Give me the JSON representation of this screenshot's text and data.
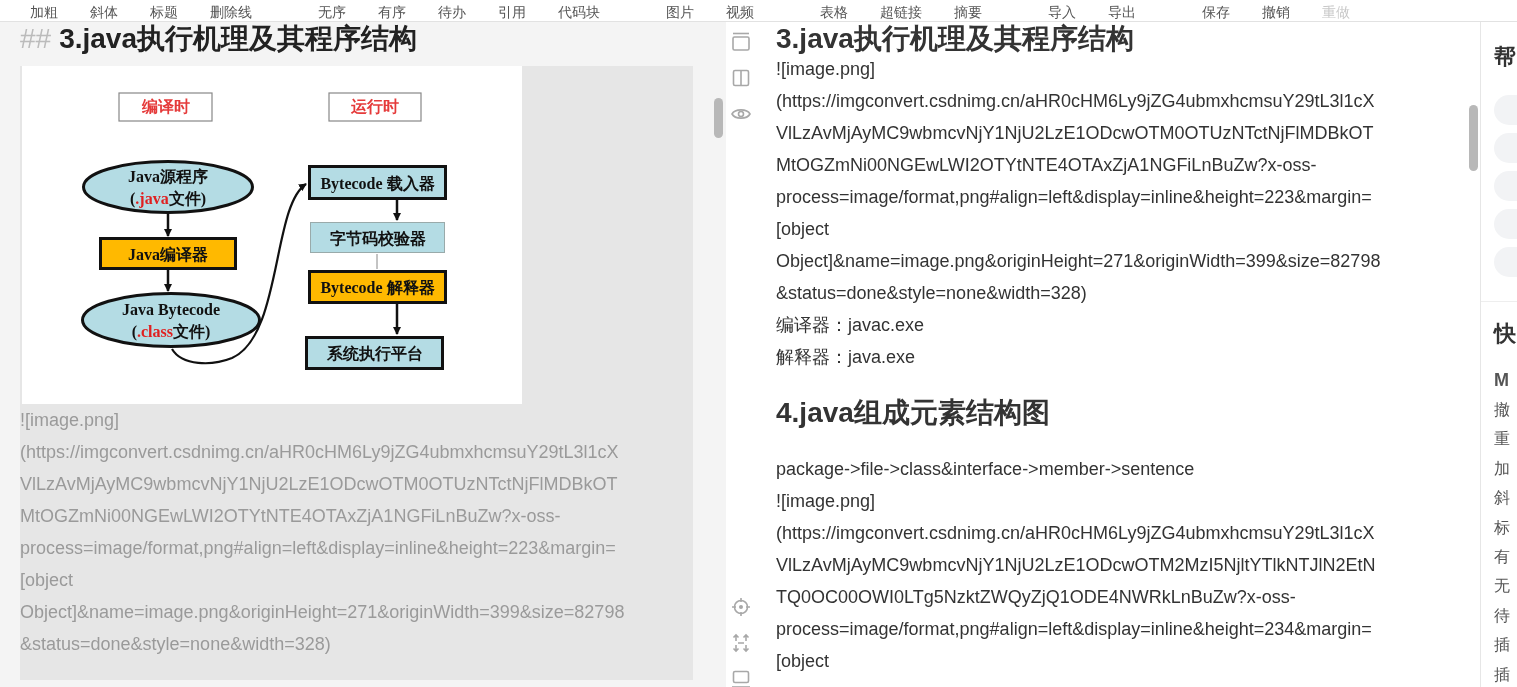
{
  "toolbar": {
    "groups": [
      [
        {
          "label": "加粗",
          "disabled": false
        },
        {
          "label": "斜体",
          "disabled": false
        },
        {
          "label": "标题",
          "disabled": false
        },
        {
          "label": "删除线",
          "disabled": false
        }
      ],
      [
        {
          "label": "无序",
          "disabled": false
        },
        {
          "label": "有序",
          "disabled": false
        },
        {
          "label": "待办",
          "disabled": false
        },
        {
          "label": "引用",
          "disabled": false
        },
        {
          "label": "代码块",
          "disabled": false
        }
      ],
      [
        {
          "label": "图片",
          "disabled": false
        },
        {
          "label": "视频",
          "disabled": false
        }
      ],
      [
        {
          "label": "表格",
          "disabled": false
        },
        {
          "label": "超链接",
          "disabled": false
        },
        {
          "label": "摘要",
          "disabled": false
        }
      ],
      [
        {
          "label": "导入",
          "disabled": false
        },
        {
          "label": "导出",
          "disabled": false
        }
      ],
      [
        {
          "label": "保存",
          "disabled": false
        },
        {
          "label": "撤销",
          "disabled": false
        },
        {
          "label": "重做",
          "disabled": true
        }
      ]
    ]
  },
  "editor": {
    "heading_mark": "##",
    "heading": "3.java执行机理及其程序结构",
    "diagram": {
      "phases": [
        "编译时",
        "运行时"
      ],
      "nodes": [
        {
          "kind": "ellipse",
          "color": "#b4dce4",
          "bold_border": true,
          "lines": [
            [
              {
                "text": "Java源程序",
                "accent": false
              }
            ],
            [
              {
                "text": "(",
                "accent": false
              },
              {
                "text": ".java",
                "accent": true
              },
              {
                "text": "文件)",
                "accent": false
              }
            ]
          ]
        },
        {
          "kind": "box",
          "color": "#ffb900",
          "bold_border": true,
          "lines": [
            [
              {
                "text": "Java编译器",
                "accent": false
              }
            ]
          ]
        },
        {
          "kind": "ellipse",
          "color": "#b4dce4",
          "bold_border": true,
          "lines": [
            [
              {
                "text": "Java Bytecode",
                "accent": false
              }
            ],
            [
              {
                "text": "(",
                "accent": false
              },
              {
                "text": ".class",
                "accent": true
              },
              {
                "text": "文件)",
                "accent": false
              }
            ]
          ]
        },
        {
          "kind": "box",
          "color": "#b4dce4",
          "bold_border": true,
          "lines": [
            [
              {
                "text": "Bytecode 载入器",
                "accent": false
              }
            ]
          ]
        },
        {
          "kind": "box",
          "color": "#b4dce4",
          "bold_border": false,
          "lines": [
            [
              {
                "text": "字节码校验器",
                "accent": false
              }
            ]
          ]
        },
        {
          "kind": "box",
          "color": "#ffb900",
          "bold_border": true,
          "lines": [
            [
              {
                "text": "Bytecode 解释器",
                "accent": false
              }
            ]
          ]
        },
        {
          "kind": "box",
          "color": "#b4dce4",
          "bold_border": true,
          "lines": [
            [
              {
                "text": "系统执行平台",
                "accent": false
              }
            ]
          ]
        }
      ]
    },
    "lines": [
      "![image.png]",
      "(https://imgconvert.csdnimg.cn/aHR0cHM6Ly9jZG4ubmxhcmsuY29tL3l1cX",
      "VlLzAvMjAyMC9wbmcvNjY1NjU2LzE1ODcwOTM0OTUzNTctNjFlMDBkOT",
      "MtOGZmNi00NGEwLWI2OTYtNTE4OTAxZjA1NGFiLnBuZw?x-oss-",
      "process=image/format,png#align=left&display=inline&height=223&margin=",
      "[object",
      "Object]&name=image.png&originHeight=271&originWidth=399&size=82798",
      "&status=done&style=none&width=328)"
    ]
  },
  "preview": {
    "blocks": [
      {
        "kind": "heading",
        "text": "3.java执行机理及其程序结构"
      },
      {
        "kind": "text",
        "lines": [
          "![image.png]",
          "(https://imgconvert.csdnimg.cn/aHR0cHM6Ly9jZG4ubmxhcmsuY29tL3l1cX",
          "VlLzAvMjAyMC9wbmcvNjY1NjU2LzE1ODcwOTM0OTUzNTctNjFlMDBkOT",
          "MtOGZmNi00NGEwLWI2OTYtNTE4OTAxZjA1NGFiLnBuZw?x-oss-",
          "process=image/format,png#align=left&display=inline&height=223&margin=",
          "[object",
          "Object]&name=image.png&originHeight=271&originWidth=399&size=82798",
          "&status=done&style=none&width=328)",
          "编译器：javac.exe",
          "解释器：java.exe"
        ]
      },
      {
        "kind": "heading",
        "text": "4.java组成元素结构图"
      },
      {
        "kind": "text",
        "lines": [
          "package->file->class&interface->member->sentence",
          "![image.png]",
          "(https://imgconvert.csdnimg.cn/aHR0cHM6Ly9jZG4ubmxhcmsuY29tL3l1cX",
          "VlLzAvMjAyMC9wbmcvNjY1NjU2LzE1ODcwOTM2MzI5NjltYTlkNTJlN2EtN",
          "TQ0OC00OWI0LTg5NzktZWQyZjQ1ODE4NWRkLnBuZw?x-oss-",
          "process=image/format,png#align=left&display=inline&height=234&margin=",
          "[object"
        ]
      }
    ]
  },
  "side_panel": {
    "help_title": "帮",
    "shortcuts_title": "快",
    "shortcuts_heading": "M",
    "shortcuts": [
      "撤",
      "重",
      "加",
      "斜",
      "标",
      "有",
      "无",
      "待",
      "插",
      "插"
    ]
  }
}
